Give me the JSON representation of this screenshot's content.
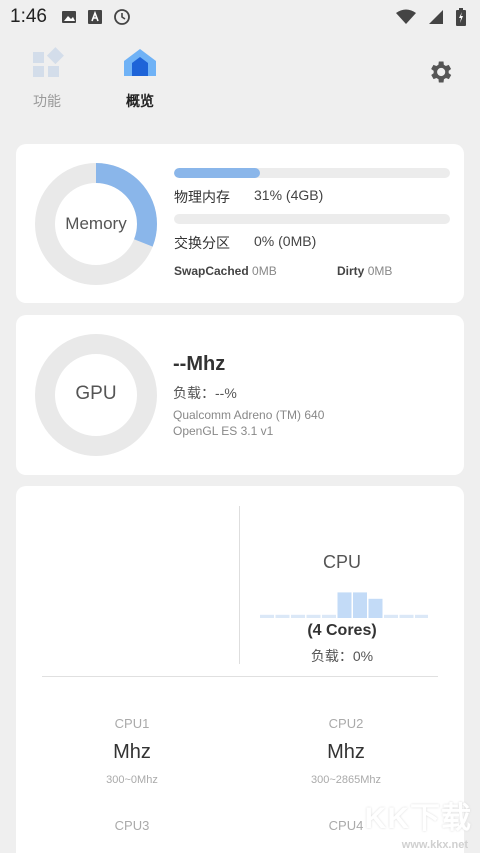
{
  "status_bar": {
    "time": "1:46",
    "icons_left": [
      "image-icon",
      "a-icon",
      "clock-icon"
    ],
    "icons_right": [
      "wifi-icon",
      "signal-icon",
      "battery-icon"
    ]
  },
  "tabs": [
    {
      "label": "功能",
      "icon": "widgets-icon",
      "active": false
    },
    {
      "label": "概览",
      "icon": "home-icon",
      "active": true
    }
  ],
  "settings_icon": "gear-icon",
  "memory": {
    "ring_label": "Memory",
    "ring_fraction": 0.31,
    "physical": {
      "label": "物理内存",
      "value": "31% (4GB)",
      "fraction": 0.31
    },
    "swap": {
      "label": "交换分区",
      "value": "0% (0MB)",
      "fraction": 0.0
    },
    "swap_cached": {
      "label": "SwapCached",
      "value": "0MB"
    },
    "dirty": {
      "label": "Dirty",
      "value": "0MB"
    }
  },
  "gpu": {
    "ring_label": "GPU",
    "freq": "--Mhz",
    "load": "负载：--%",
    "renderer": "Qualcomm Adreno (TM) 640",
    "opengl": "OpenGL ES 3.1 v1"
  },
  "cpu": {
    "title": "CPU",
    "cores": "(4 Cores)",
    "load": "负载：0%",
    "graph_levels": [
      0.1,
      0.1,
      0.1,
      0.1,
      0.1,
      0.8,
      0.8,
      0.6,
      0.1,
      0.1,
      0.1
    ],
    "core_list": [
      {
        "name": "CPU1",
        "freq": "Mhz",
        "range": "300~0Mhz"
      },
      {
        "name": "CPU2",
        "freq": "Mhz",
        "range": "300~2865Mhz"
      },
      {
        "name": "CPU3",
        "freq": "",
        "range": ""
      },
      {
        "name": "CPU4",
        "freq": "",
        "range": ""
      }
    ]
  },
  "watermark": {
    "text": "KK下载",
    "url": "www.kkx.net"
  },
  "colors": {
    "accent": "#8ab6ea",
    "accent_dark": "#1d63d8",
    "card": "#ffffff",
    "background": "#efefef"
  }
}
